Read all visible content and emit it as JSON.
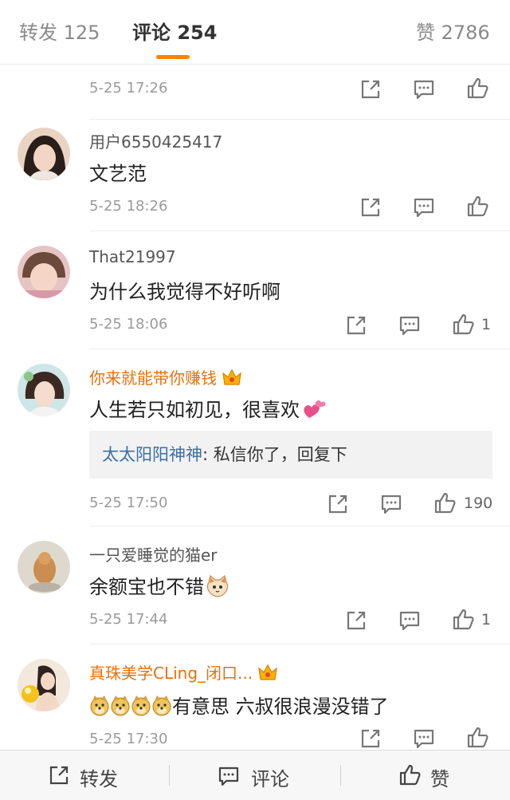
{
  "tabs": {
    "repost": "转发 125",
    "comments": "评论 254",
    "likes": "赞 2786"
  },
  "comments": [
    {
      "time": "5-25 17:26"
    },
    {
      "username": "用户6550425417",
      "text": "文艺范",
      "time": "5-25 18:26"
    },
    {
      "username": "That21997",
      "text": "为什么我觉得不好听啊",
      "time": "5-25 18:06",
      "likes": "1"
    },
    {
      "username": "你来就能带你赚钱",
      "text": "人生若只如初见，很喜欢",
      "reply_user": "太太阳阳神神",
      "reply_text": ": 私信你了，回复下",
      "time": "5-25 17:50",
      "likes": "190"
    },
    {
      "username": "一只爱睡觉的猫er",
      "text": "余额宝也不错",
      "time": "5-25 17:44",
      "likes": "1"
    },
    {
      "username": "真珠美学CLing_闭口...",
      "text": "有意思 六叔很浪漫没错了",
      "time": "5-25 17:30"
    }
  ],
  "bottom": {
    "repost": "转发",
    "comment": "评论",
    "like": "赞"
  },
  "colors": {
    "accent": "#ff8200",
    "vip_name": "#e8700a",
    "reply_name": "#3b6fa6"
  },
  "icons": [
    "share-icon",
    "comment-icon",
    "like-icon",
    "crown-icon",
    "heart-emoji",
    "cat-emoji",
    "doge-emoji"
  ]
}
